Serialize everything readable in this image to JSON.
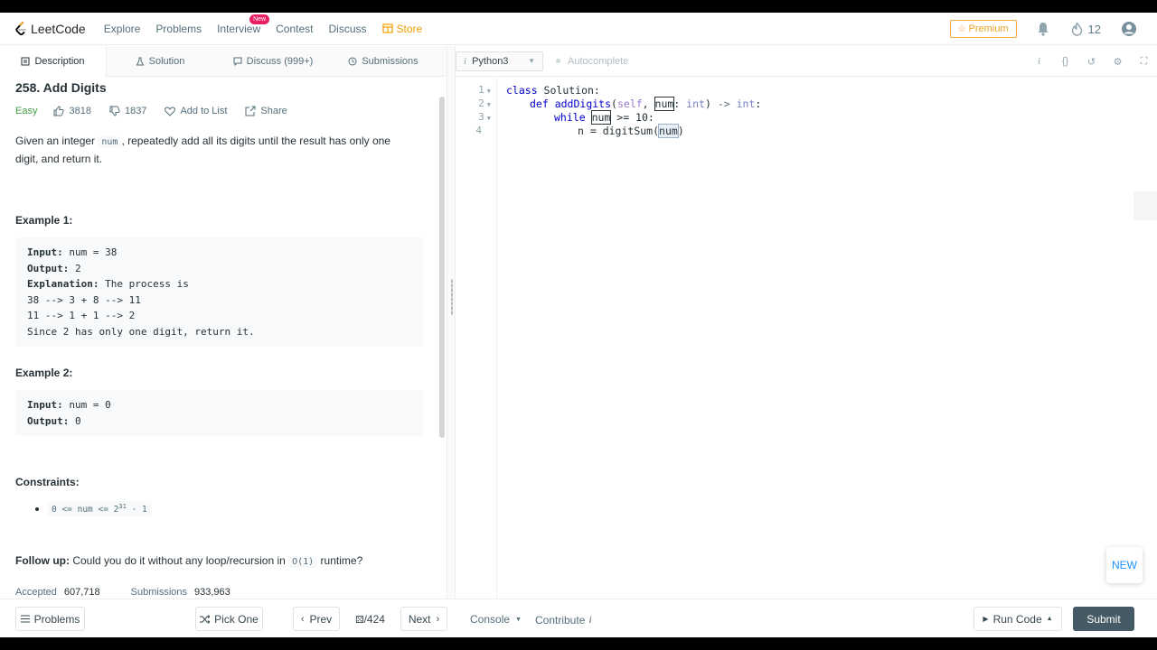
{
  "nav": {
    "logo_text": "LeetCode",
    "links": [
      "Explore",
      "Problems",
      "Interview",
      "Contest",
      "Discuss"
    ],
    "interview_badge": "New",
    "store_label": "Store",
    "premium_label": "Premium",
    "streak_count": "12"
  },
  "tabs": {
    "description": "Description",
    "solution": "Solution",
    "discuss": "Discuss (999+)",
    "submissions": "Submissions"
  },
  "problem": {
    "title": "258. Add Digits",
    "difficulty": "Easy",
    "likes": "3818",
    "dislikes": "1837",
    "add_to_list": "Add to List",
    "share": "Share",
    "desc_pre": "Given an integer ",
    "desc_code": "num",
    "desc_post": ", repeatedly add all its digits until the result has only one digit, and return it.",
    "example1_heading": "Example 1:",
    "example1": {
      "input_label": "Input:",
      "input_value": " num = 38",
      "output_label": "Output:",
      "output_value": " 2",
      "explanation_label": "Explanation:",
      "explanation_value": " The process is",
      "line1": "38 --> 3 + 8 --> 11",
      "line2": "11 --> 1 + 1 --> 2",
      "line3": "Since 2 has only one digit, return it."
    },
    "example2_heading": "Example 2:",
    "example2": {
      "input_label": "Input:",
      "input_value": " num = 0",
      "output_label": "Output:",
      "output_value": " 0"
    },
    "constraints_heading": "Constraints:",
    "constraint_pre": "0 <= num <= 2",
    "constraint_sup": "31",
    "constraint_post": " - 1",
    "followup_label": "Follow up:",
    "followup_pre": " Could you do it without any loop/recursion in ",
    "followup_code": "O(1)",
    "followup_post": " runtime?",
    "accepted_label": "Accepted",
    "accepted_value": "607,718",
    "submissions_label": "Submissions",
    "submissions_value": "933,963"
  },
  "editor": {
    "language": "Python3",
    "autocomplete_label": "Autocomplete",
    "line_numbers": [
      "1",
      "2",
      "3",
      "4"
    ],
    "code": {
      "l1_kw": "class",
      "l1_name": " Solution:",
      "l2_kw": "def",
      "l2_fn": " addDigits",
      "l2_open": "(",
      "l2_self": "self",
      "l2_comma": ", ",
      "l2_param": "num",
      "l2_colon": ": ",
      "l2_type": "int",
      "l2_close": ") ",
      "l2_arrow": "->",
      "l2_rtype": "int",
      "l2_end": ":",
      "l3_kw": "while",
      "l3_var": "num",
      "l3_rest": " >= 10:",
      "l4_pre": "n = ",
      "l4_fn": "digitSum",
      "l4_open": "(",
      "l4_arg": "num",
      "l4_close": ")"
    },
    "new_button": "NEW"
  },
  "bottom": {
    "problems": "Problems",
    "pick_one": "Pick One",
    "prev": "Prev",
    "page": "/424",
    "next": "Next",
    "console": "Console",
    "contribute": "Contribute",
    "run_code": "Run Code",
    "submit": "Submit"
  },
  "colors": {
    "accent_green": "#43a047",
    "store_orange": "#f59f00",
    "submit_bg": "#455a64",
    "keyword_blue": "#0000cc"
  }
}
